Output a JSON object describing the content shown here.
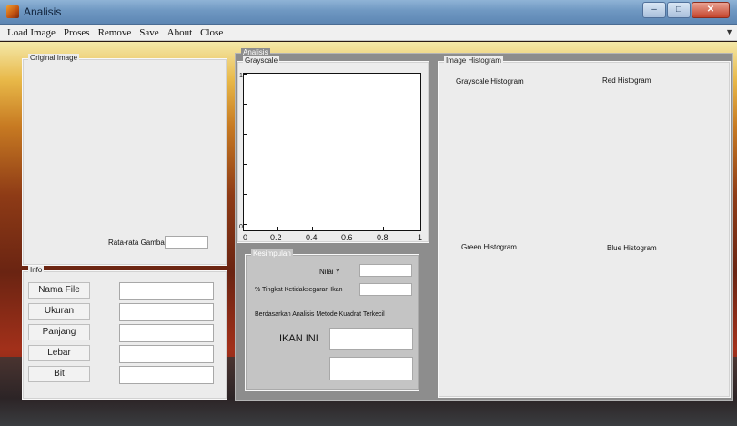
{
  "window": {
    "title": "Analisis"
  },
  "menu": [
    "Load Image",
    "Proses",
    "Remove",
    "Save",
    "About",
    "Close"
  ],
  "original_image": {
    "legend": "Original Image",
    "avg_label": "Rata-rata Gambar",
    "avg_value": ""
  },
  "info": {
    "legend": "Info",
    "rows": [
      {
        "label": "Nama File",
        "value": ""
      },
      {
        "label": "Ukuran",
        "value": ""
      },
      {
        "label": "Panjang",
        "value": ""
      },
      {
        "label": "Lebar",
        "value": ""
      },
      {
        "label": "Bit",
        "value": ""
      }
    ]
  },
  "analisis": {
    "legend": "Analisis",
    "grayscale": {
      "legend": "Grayscale",
      "xticks": [
        "0",
        "0.2",
        "0.4",
        "0.6",
        "0.8",
        "1"
      ],
      "yticks": [
        "0",
        "",
        "",
        "",
        "",
        "",
        "1"
      ]
    },
    "kesimpulan": {
      "legend": "Kesimpulan",
      "nilai_y_label": "Nilai Y",
      "nilai_y_value": "",
      "tingkat_label": "% Tingkat Ketidaksegaran Ikan",
      "tingkat_value": "",
      "berdasarkan_text": "Berdasarkan Analisis Metode Kuadrat Terkecil",
      "ikan_label": "IKAN INI",
      "result_1": "",
      "result_2": ""
    }
  },
  "histogram": {
    "legend": "Image Histogram",
    "grayscale_title": "Grayscale Histogram",
    "red_title": "Red Histogram",
    "green_title": "Green Histogram",
    "blue_title": "Blue Histogram"
  }
}
